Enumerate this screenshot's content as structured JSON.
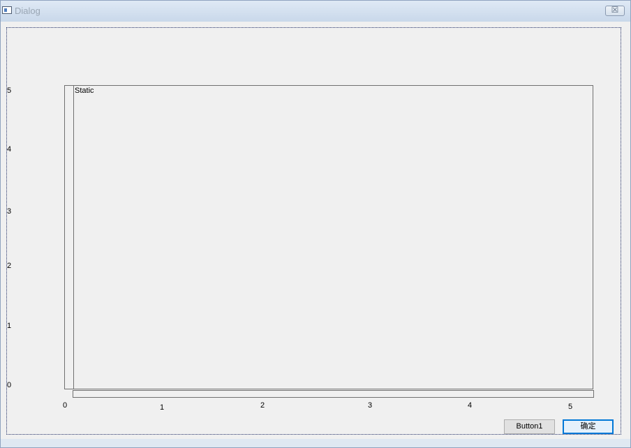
{
  "window": {
    "title": "Dialog",
    "close_glyph": "☒"
  },
  "static": {
    "label": "Static"
  },
  "axes": {
    "y_ticks": [
      "5",
      "4",
      "3",
      "2",
      "1",
      "0"
    ],
    "x_ticks": [
      "0",
      "1",
      "2",
      "3",
      "4",
      "5"
    ]
  },
  "buttons": {
    "button1_label": "Button1",
    "ok_label": "确定"
  },
  "colors": {
    "accent": "#0078d7",
    "title_text": "#9aa6b4"
  }
}
